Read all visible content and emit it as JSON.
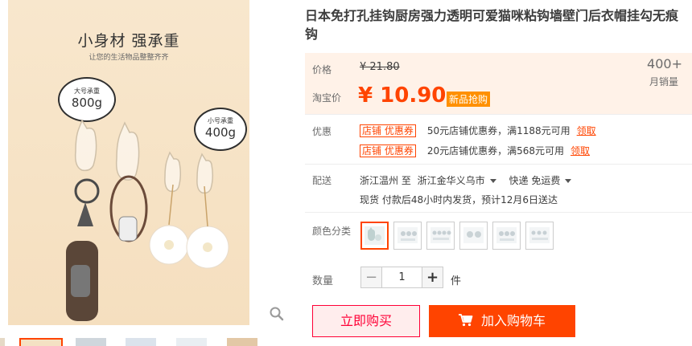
{
  "gallery": {
    "img_title": "小身材 强承重",
    "img_subtitle": "让您的生活物品整整齐齐",
    "bubble_large_label": "大号承重",
    "bubble_large_value": "800g",
    "bubble_small_label": "小号承重",
    "bubble_small_value": "400g",
    "zoom_icon": "magnifier-icon"
  },
  "product": {
    "title": "日本免打孔挂钩厨房强力透明可爱猫咪粘钩墙壁门后衣帽挂勾无痕钩"
  },
  "price": {
    "label": "价格",
    "original": "¥ 21.80",
    "taobao_label": "淘宝价",
    "sale": "¥ 10.90",
    "badge": "新品抢购",
    "sales_count": "400+",
    "sales_label": "月销量"
  },
  "promo": {
    "label": "优惠",
    "coupons": [
      {
        "tag": "店铺 优惠券",
        "text": "50元店铺优惠券，满1188元可用",
        "link": "领取"
      },
      {
        "tag": "店铺 优惠券",
        "text": "20元店铺优惠券，满568元可用",
        "link": "领取"
      }
    ]
  },
  "delivery": {
    "label": "配送",
    "from": "浙江温州 至",
    "to": "浙江金华义乌市",
    "method": "快递 免运费",
    "stock_info": "现货 付款后48小时内发货，预计12月6日送达"
  },
  "color": {
    "label": "颜色分类"
  },
  "quantity": {
    "label": "数量",
    "minus": "−",
    "value": "1",
    "plus": "+",
    "unit": "件"
  },
  "actions": {
    "buy_now": "立即购买",
    "add_cart": "加入购物车",
    "cart_icon": "shopping-cart-icon"
  },
  "colors": {
    "accent": "#ff4400",
    "buy_now_text": "#ff0036",
    "badge": "#ff9000",
    "price_panel_bg": "#fff2e8"
  }
}
